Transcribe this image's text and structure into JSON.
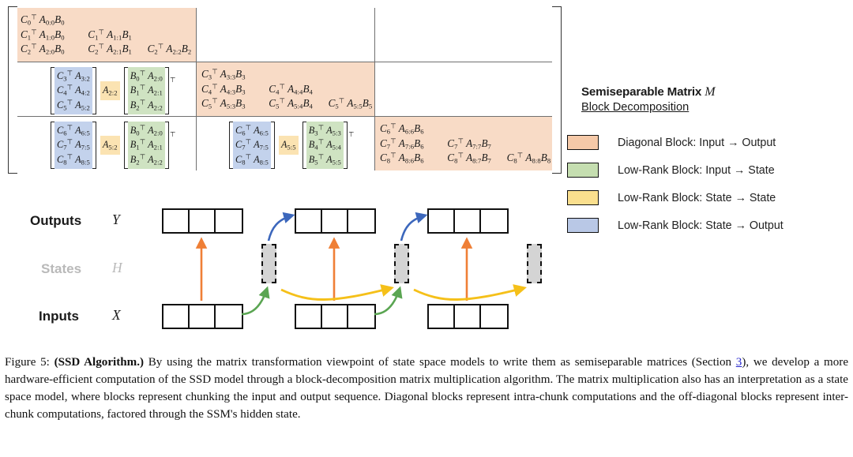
{
  "figure": {
    "number": "Figure 5:",
    "bold_title": "(SSD Algorithm.)",
    "caption_rest": " By using the matrix transformation viewpoint of state space models to write them as semiseparable matrices (Section ",
    "link": "3",
    "caption_tail": "), we develop a more hardware-efficient computation of the SSD model through a block-decomposition matrix multiplication algorithm. The matrix multiplication also has an interpretation as a state space model, where blocks represent chunking the input and output sequence. Diagonal blocks represent intra-chunk computations and the off-diagonal blocks represent inter-chunk computations, factored through the SSM's hidden state."
  },
  "legend": {
    "title": "Semiseparable Matrix",
    "title_symbol": "M",
    "subtitle": "Block Decomposition",
    "items": [
      {
        "label": "Diagonal Block: Input → Output",
        "color": "#f5c9a8"
      },
      {
        "label": "Low-Rank Block: Input → State",
        "color": "#c5deb0"
      },
      {
        "label": "Low-Rank Block: State → State",
        "color": "#fadf8e"
      },
      {
        "label": "Low-Rank Block: State → Output",
        "color": "#b9c8e6"
      }
    ]
  },
  "matrix": {
    "diag_blocks": [
      {
        "id": "block-0-0",
        "rows": [
          [
            "C0ᵀ A0:0 B0"
          ],
          [
            "C1ᵀ A1:0 B0",
            "C1ᵀ A1:1 B1"
          ],
          [
            "C2ᵀ A2:0 B0",
            "C2ᵀ A2:1 B1",
            "C2ᵀ A2:2 B2"
          ]
        ]
      },
      {
        "id": "block-1-1",
        "rows": [
          [
            "C3ᵀ A3:3 B3"
          ],
          [
            "C4ᵀ A4:3 B3",
            "C4ᵀ A4:4 B4"
          ],
          [
            "C5ᵀ A5:3 B3",
            "C5ᵀ A5:4 B4",
            "C5ᵀ A5:5 B5"
          ]
        ]
      },
      {
        "id": "block-2-2",
        "rows": [
          [
            "C6ᵀ A6:6 B6"
          ],
          [
            "C7ᵀ A7:6 B6",
            "C7ᵀ A7:7 B7"
          ],
          [
            "C8ᵀ A8:6 B6",
            "C8ᵀ A8:7 B7",
            "C8ᵀ A8:8 B8"
          ]
        ]
      }
    ],
    "lowrank_blocks": [
      {
        "id": "block-1-0",
        "c_stack": [
          "C3ᵀ A3:2",
          "C4ᵀ A4:2",
          "C5ᵀ A5:2"
        ],
        "a_mid": "A2:2",
        "b_stack": [
          "B0ᵀ A2:0",
          "B1ᵀ A2:1",
          "B2ᵀ A2:2"
        ],
        "transpose": "⊤"
      },
      {
        "id": "block-2-0",
        "c_stack": [
          "C6ᵀ A6:5",
          "C7ᵀ A7:5",
          "C8ᵀ A8:5"
        ],
        "a_mid": "A5:2",
        "b_stack": [
          "B0ᵀ A2:0",
          "B1ᵀ A2:1",
          "B2ᵀ A2:2"
        ],
        "transpose": "⊤"
      },
      {
        "id": "block-2-1",
        "c_stack": [
          "C6ᵀ A6:5",
          "C7ᵀ A7:5",
          "C8ᵀ A8:5"
        ],
        "a_mid": "A5:5",
        "b_stack": [
          "B3ᵀ A5:3",
          "B4ᵀ A5:4",
          "B5ᵀ A5:5"
        ],
        "transpose": "⊤"
      }
    ]
  },
  "diagram": {
    "rows": [
      {
        "label": "Outputs",
        "symbol": "Y"
      },
      {
        "label": "States",
        "symbol": "H"
      },
      {
        "label": "Inputs",
        "symbol": "X"
      }
    ],
    "chunks": 3,
    "cells_per_chunk": 3,
    "arrow_colors": {
      "input_to_output": "#ef7f36",
      "input_to_state": "#5aa552",
      "state_to_state": "#f5c019",
      "state_to_output": "#3c67bc"
    }
  }
}
